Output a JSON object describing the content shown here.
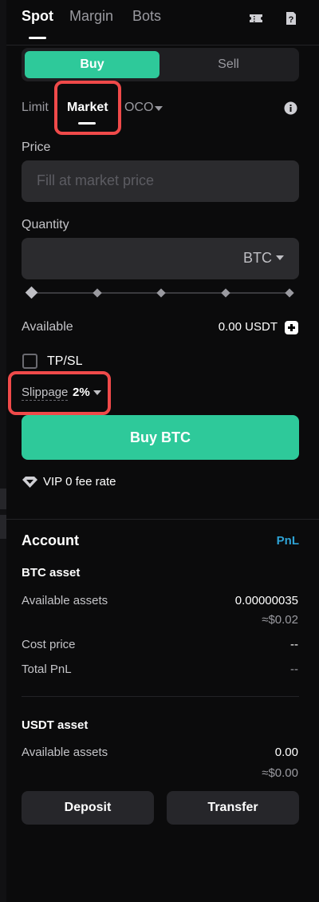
{
  "tabs": [
    {
      "label": "Spot",
      "active": true
    },
    {
      "label": "Margin",
      "active": false
    },
    {
      "label": "Bots",
      "active": false
    }
  ],
  "toggle": {
    "buy": "Buy",
    "sell": "Sell",
    "selected": "Buy"
  },
  "order_types": [
    {
      "label": "Limit",
      "active": false
    },
    {
      "label": "Market",
      "active": true
    },
    {
      "label": "OCO",
      "active": false
    }
  ],
  "price": {
    "label": "Price",
    "placeholder": "Fill at market price"
  },
  "quantity": {
    "label": "Quantity",
    "unit": "BTC",
    "slider_percent": 0
  },
  "available": {
    "label": "Available",
    "value": "0.00 USDT"
  },
  "tpsl": {
    "label": "TP/SL",
    "checked": false
  },
  "slippage": {
    "label": "Slippage",
    "value": "2%"
  },
  "buy_button": "Buy BTC",
  "fee": {
    "text": "VIP 0 fee rate"
  },
  "account": {
    "title": "Account",
    "pnl_link": "PnL",
    "btc": {
      "title": "BTC asset",
      "available_label": "Available assets",
      "available_value": "0.00000035",
      "available_approx": "≈$0.02",
      "cost_label": "Cost price",
      "cost_value": "--",
      "pnl_label": "Total PnL",
      "pnl_value": "--"
    },
    "usdt": {
      "title": "USDT asset",
      "available_label": "Available assets",
      "available_value": "0.00",
      "available_approx": "≈$0.00"
    },
    "deposit": "Deposit",
    "transfer": "Transfer"
  },
  "colors": {
    "accent": "#2ec99a",
    "highlight": "#f04a4a",
    "link": "#2ea3d6"
  },
  "icons": [
    "ticket-icon",
    "help-doc-icon",
    "info-icon",
    "chevron-down-icon",
    "plus-icon",
    "vip-diamond-icon"
  ]
}
